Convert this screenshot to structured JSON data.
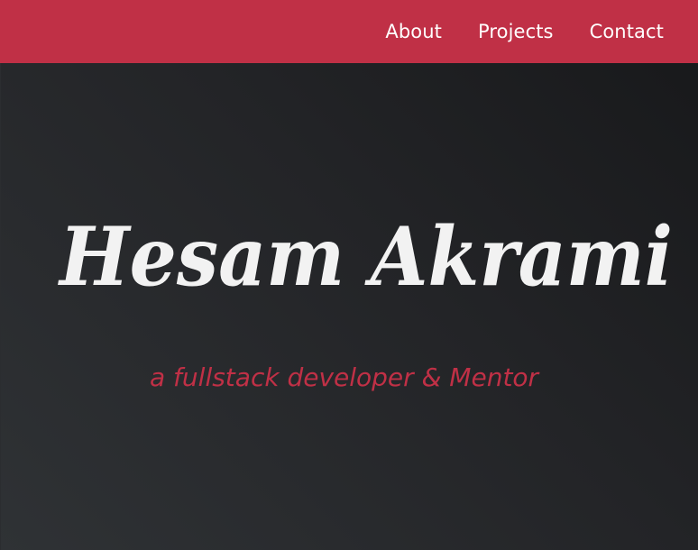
{
  "nav": {
    "links": [
      {
        "label": "About"
      },
      {
        "label": "Projects"
      },
      {
        "label": "Contact"
      }
    ]
  },
  "hero": {
    "name": "Hesam Akrami",
    "tagline": "a fullstack developer & Mentor"
  },
  "colors": {
    "accent": "#c03046",
    "background_dark": "#1f2023",
    "name_text": "#f2f2f2"
  }
}
